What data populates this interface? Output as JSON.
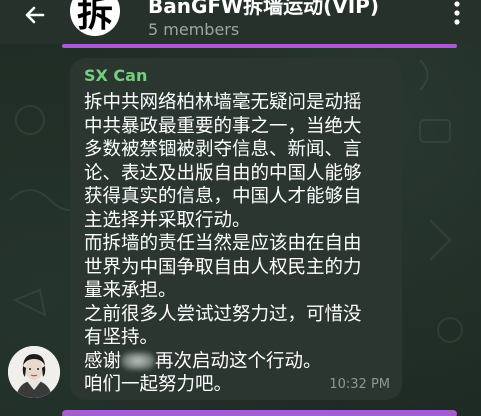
{
  "header": {
    "title": "BanGFW拆墙运动(VIP)",
    "subtitle": "5 members",
    "avatar_char": "拆",
    "back_icon": "back-arrow-icon",
    "menu_icon": "more-vertical-icon"
  },
  "message": {
    "sender": "SX Can",
    "lines": [
      "拆中共网络柏林墙毫无疑问是动摇",
      "中共暴政最重要的事之一，当绝大",
      "多数被禁锢被剥夺信息、新闻、言",
      "论、表达及出版自由的中国人能够",
      "获得真实的信息，中国人才能够自",
      "主选择并采取行动。",
      "而拆墙的责任当然是应该由在自由",
      "世界为中国争取自由人权民主的力",
      "量来承担。",
      "之前很多人尝试过努力过，可惜没",
      "有坚持。"
    ],
    "line_thanks_prefix": "感谢",
    "line_thanks_suffix": "再次启动这个行动。",
    "line_last": "咱们一起努力吧。",
    "time": "10:32 PM"
  },
  "colors": {
    "background": "#1e2b24",
    "bubble": "#2c3631",
    "sender": "#74d07a",
    "accent": "#a85ad1"
  }
}
